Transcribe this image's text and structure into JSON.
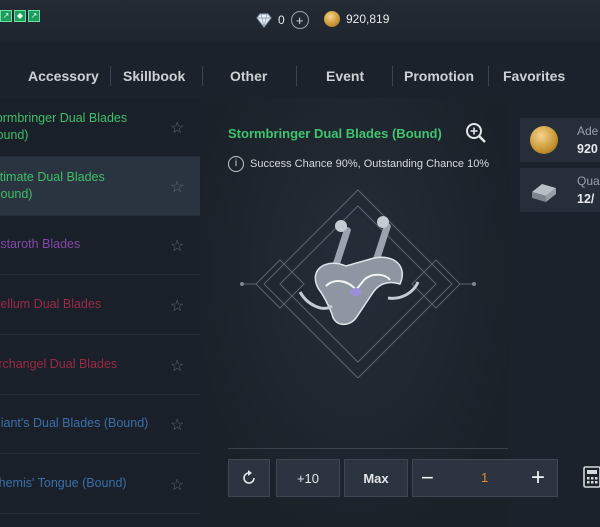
{
  "top": {
    "diamonds": "0",
    "adena": "920,819",
    "buff_icons": [
      "buff-1",
      "buff-2",
      "buff-3"
    ]
  },
  "tabs": [
    "Accessory",
    "Skillbook",
    "Other",
    "Event",
    "Promotion",
    "Favorites"
  ],
  "items": [
    {
      "name": "Stormbringer Dual Blades (Bound)",
      "color": "#3fbf66"
    },
    {
      "name": "Ultimate Dual Blades (Bound)",
      "color": "#3fbf66"
    },
    {
      "name": "Astaroth Blades",
      "color": "#8448a8"
    },
    {
      "name": "Pellum Dual Blades",
      "color": "#9b2a44"
    },
    {
      "name": "Archangel Dual Blades",
      "color": "#9b2a44"
    },
    {
      "name": "Giant's Dual Blades (Bound)",
      "color": "#3b6ea8"
    },
    {
      "name": "Themis' Tongue (Bound)",
      "color": "#3b6ea8"
    }
  ],
  "detail": {
    "title": "Stormbringer Dual Blades (Bound)",
    "chance": "Success Chance 90%, Outstanding Chance 10%"
  },
  "controls": {
    "plus10": "+10",
    "max": "Max",
    "quantity": "1",
    "minus": "−",
    "plus": "+"
  },
  "materials": [
    {
      "label": "Ade",
      "count": "920"
    },
    {
      "label": "Qua",
      "count": "12/"
    }
  ]
}
